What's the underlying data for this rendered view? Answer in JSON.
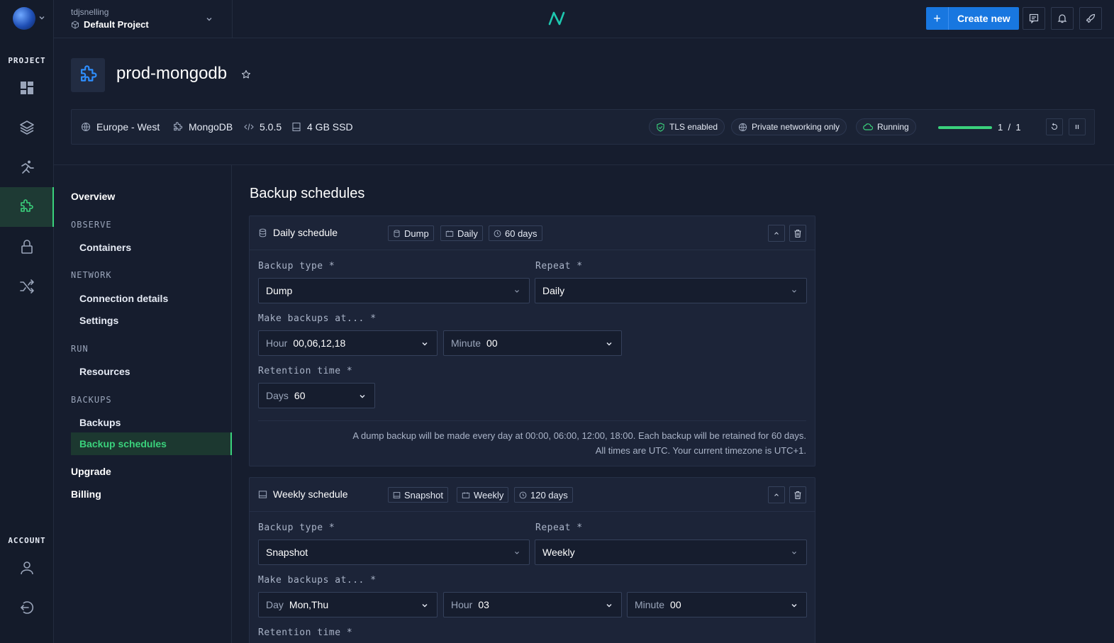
{
  "rail": {
    "project_label": "PROJECT",
    "account_label": "ACCOUNT",
    "items": [
      "dashboard-icon",
      "layers-icon",
      "runner-icon",
      "puzzle-icon",
      "lock-icon",
      "shuffle-icon"
    ],
    "account_items": [
      "user-icon",
      "logout-icon"
    ]
  },
  "topbar": {
    "owner": "tdjsnelling",
    "project": "Default Project",
    "create_label": "Create new",
    "create_plus": "+"
  },
  "addon": {
    "name": "prod-mongodb",
    "region": "Europe - West",
    "engine": "MongoDB",
    "version": "5.0.5",
    "storage": "4 GB SSD",
    "tls": "TLS enabled",
    "networking": "Private networking only",
    "status": "Running",
    "replicas_progress": 1.0,
    "replicas_current": "1",
    "replicas_sep": "/",
    "replicas_total": "1"
  },
  "nav": {
    "overview": "Overview",
    "observe": "OBSERVE",
    "containers": "Containers",
    "network": "NETWORK",
    "connection": "Connection details",
    "settings": "Settings",
    "run": "RUN",
    "resources": "Resources",
    "backups_section": "BACKUPS",
    "backups": "Backups",
    "schedules": "Backup schedules",
    "upgrade": "Upgrade",
    "billing": "Billing"
  },
  "main": {
    "title": "Backup schedules",
    "daily": {
      "title": "Daily schedule",
      "tag_type": "Dump",
      "tag_repeat": "Daily",
      "tag_retention": "60 days",
      "label_type": "Backup type *",
      "type_value": "Dump",
      "label_repeat": "Repeat *",
      "repeat_value": "Daily",
      "label_at": "Make backups at... *",
      "hour_prefix": "Hour",
      "hour_value": "00,06,12,18",
      "minute_prefix": "Minute",
      "minute_value": "00",
      "label_retention": "Retention time *",
      "days_prefix": "Days",
      "days_value": "60",
      "note1": "A dump backup will be made every day at 00:00, 06:00, 12:00, 18:00. Each backup will be retained for 60 days.",
      "note2": "All times are UTC. Your current timezone is UTC+1."
    },
    "weekly": {
      "title": "Weekly schedule",
      "tag_type": "Snapshot",
      "tag_repeat": "Weekly",
      "tag_retention": "120 days",
      "label_type": "Backup type *",
      "type_value": "Snapshot",
      "label_repeat": "Repeat *",
      "repeat_value": "Weekly",
      "label_at": "Make backups at... *",
      "day_prefix": "Day",
      "day_value": "Mon,Thu",
      "hour_prefix": "Hour",
      "hour_value": "03",
      "minute_prefix": "Minute",
      "minute_value": "00",
      "label_retention": "Retention time *"
    }
  },
  "colors": {
    "accent_green": "#3ad27c",
    "primary_blue": "#1877e0",
    "background": "#161d2e"
  }
}
